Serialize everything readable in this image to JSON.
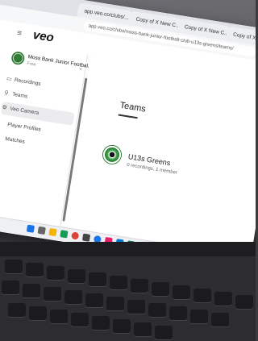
{
  "browser": {
    "tabs": [
      {
        "label": "app.veo.co/clubs/..."
      },
      {
        "label": "Copy of X New C..."
      },
      {
        "label": "Copy of X New C..."
      },
      {
        "label": "Copy of X New C..."
      }
    ],
    "url": "app.veo.co/clubs/moss-bank-junior-football-club-u13s-greens/teams/"
  },
  "app": {
    "logo": "veo",
    "club": {
      "name": "Moss Bank Junior Footbal...",
      "plan": "Free"
    },
    "nav": [
      {
        "icon": "▭",
        "label": "Recordings"
      },
      {
        "icon": "⚲",
        "label": "Teams"
      },
      {
        "icon": "⚙",
        "label": "Veo Camera"
      },
      {
        "icon": "",
        "label": "Player Profiles"
      },
      {
        "icon": "",
        "label": "Matches"
      }
    ]
  },
  "main": {
    "title": "Teams",
    "team": {
      "name": "U13s Greens",
      "meta": "0 recordings, 1 member"
    }
  },
  "colors": {
    "accent": "#1a73e8",
    "team_green": "#2c7a36"
  }
}
